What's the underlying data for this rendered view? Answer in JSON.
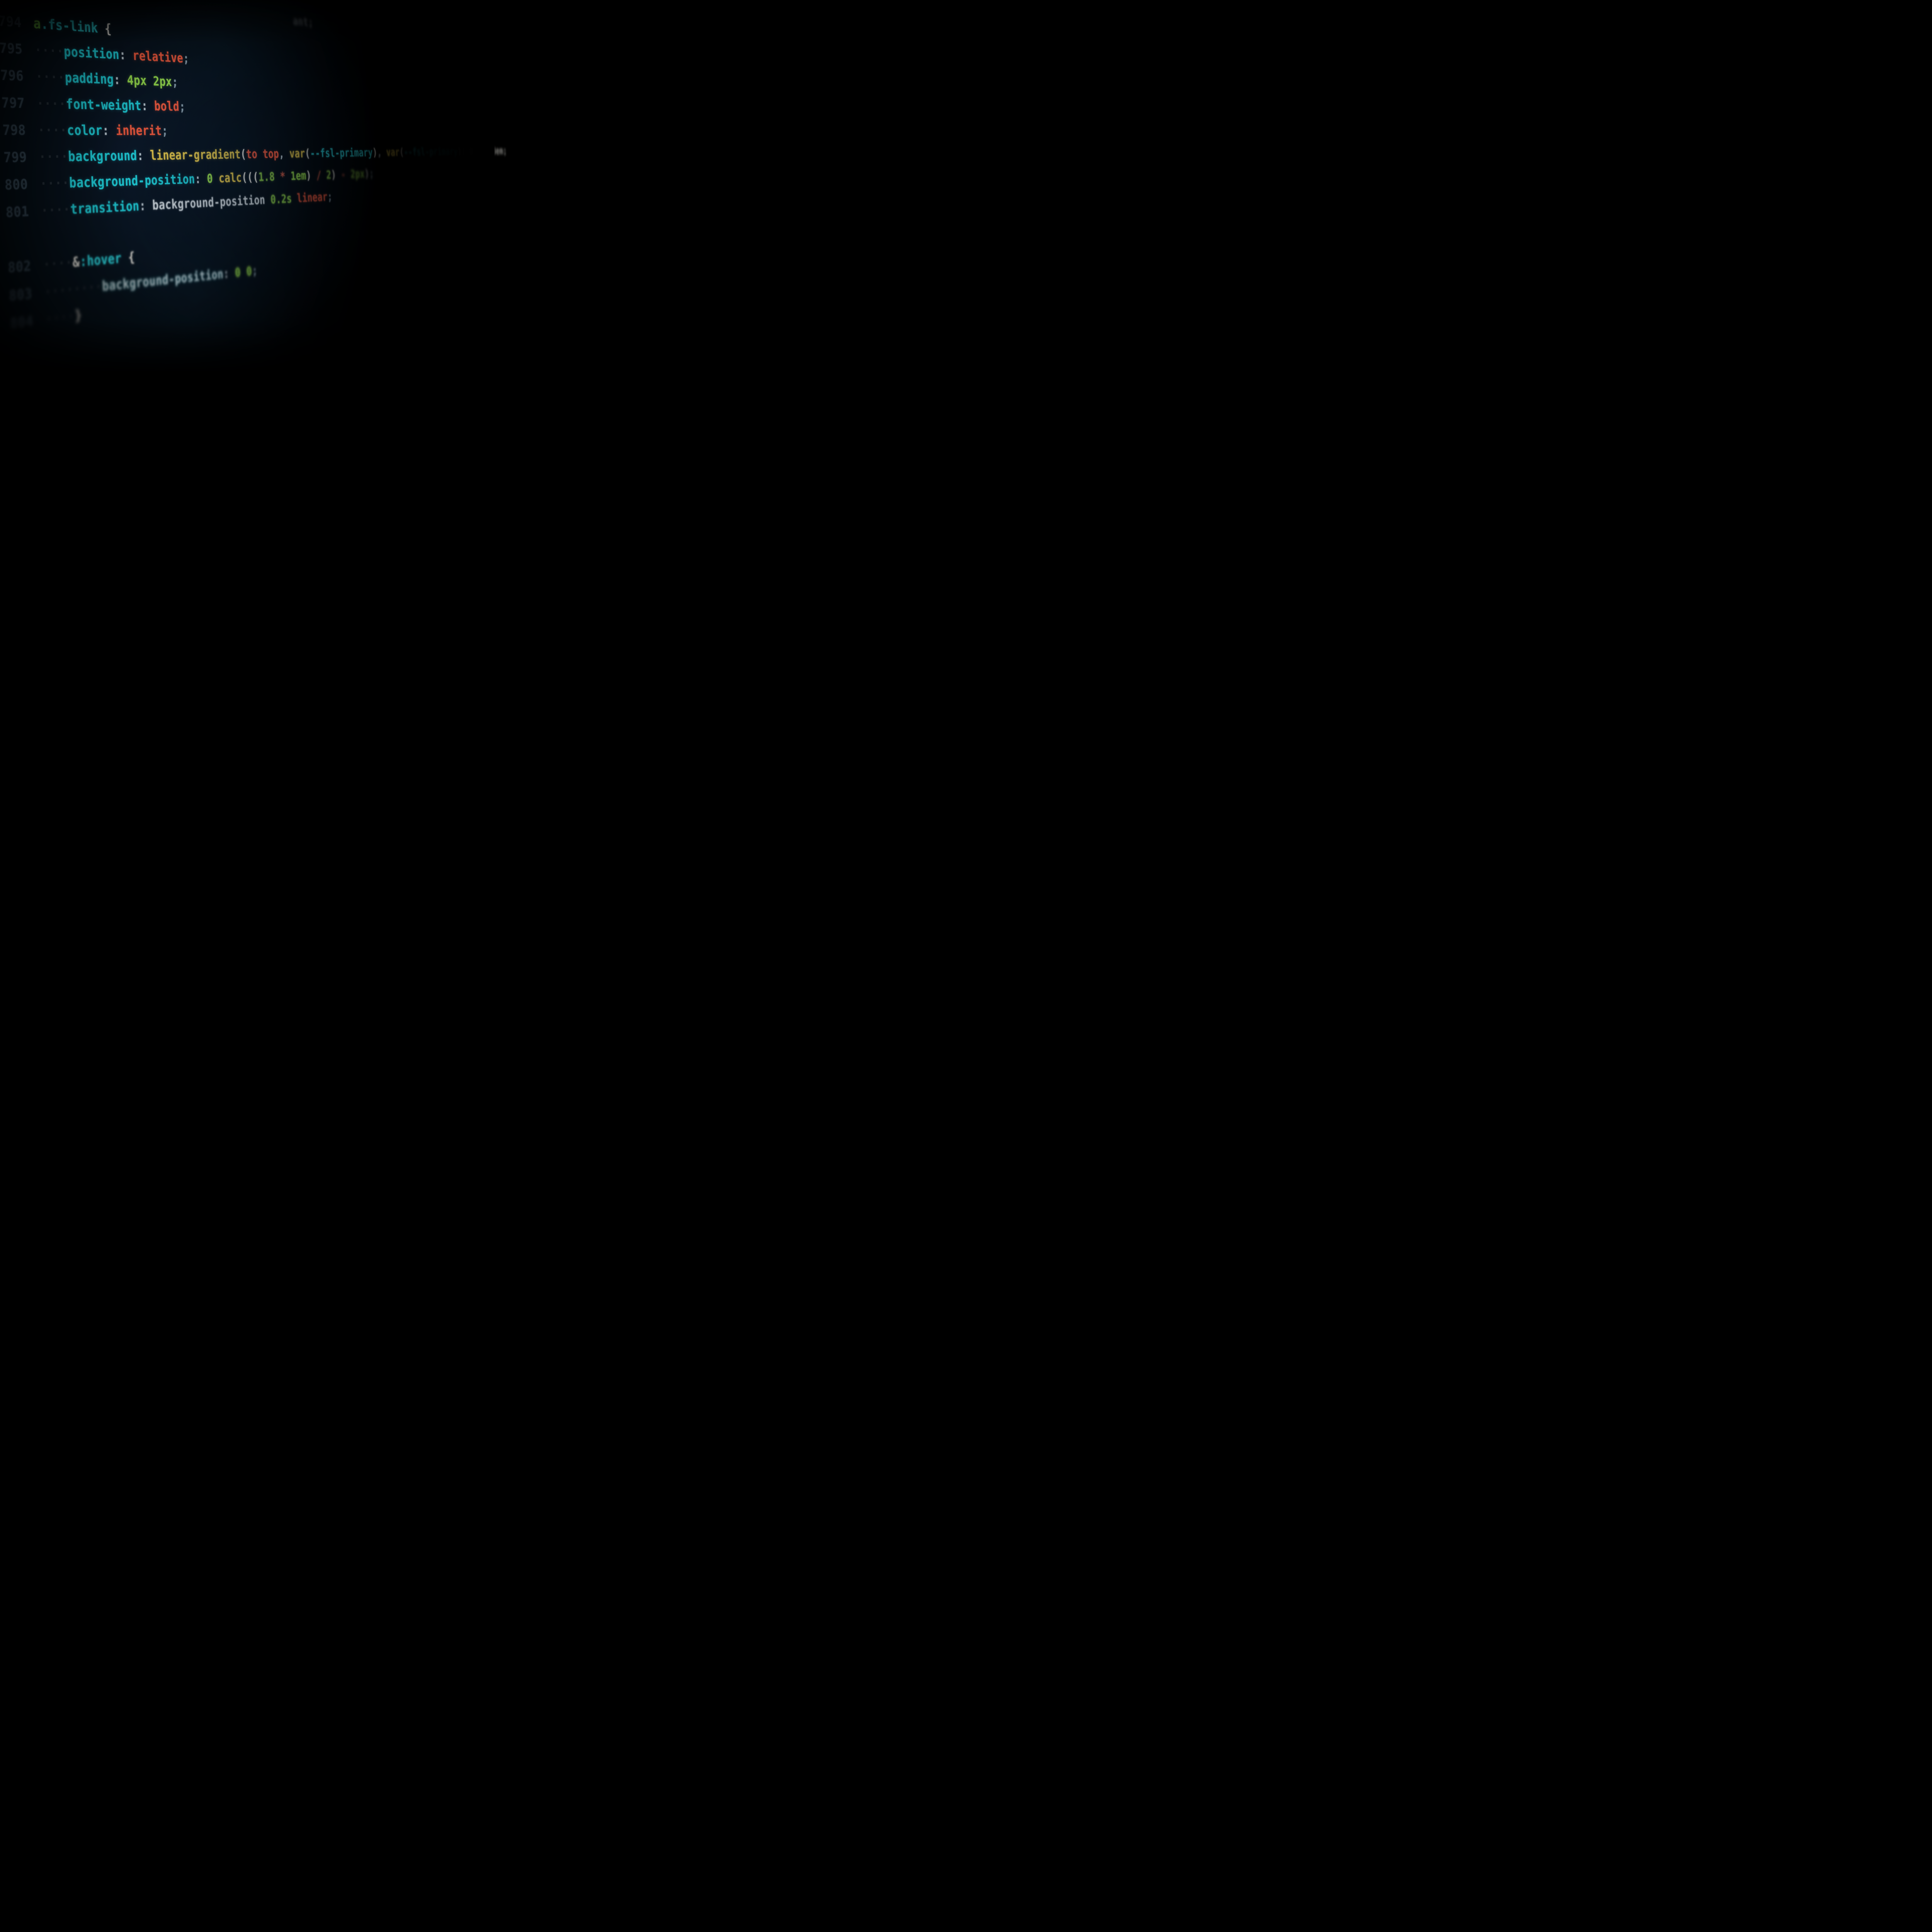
{
  "gutter": {
    "start": 794,
    "lines": [
      "794",
      "795",
      "796",
      "797",
      "798",
      "799",
      "800",
      "801",
      "802",
      "803",
      "804"
    ]
  },
  "top_fragment": "ant;",
  "code": {
    "selector_tag": "a",
    "selector_class": ".fs-link",
    "brace_open": " {",
    "brace_close": "}",
    "indent_dots_1": "····",
    "indent_dots_2": "········",
    "rules": [
      {
        "prop": "position",
        "value_kw": "relative"
      },
      {
        "prop": "padding",
        "value_nums": [
          "4px",
          "2px"
        ]
      },
      {
        "prop": "font-weight",
        "value_kw": "bold"
      },
      {
        "prop": "color",
        "value_kw": "inherit"
      },
      {
        "prop": "background",
        "func": "linear-gradient",
        "args_leading_kw": "to",
        "args_leading_kw2": "top",
        "comma": ",",
        "var_func": "var",
        "var1": "--fsl-primary",
        "var2": "--fsl-primary",
        "trail": ") 0 / 1.8em;"
      },
      {
        "prop": "background-position",
        "leading_num": "0",
        "func": "calc",
        "expr_open": "(((",
        "n1": "1.8",
        "op1": " * ",
        "unit1": "1em",
        "close1": ")",
        "op2": " / ",
        "n2": "2",
        "close2": ")",
        "op3": " - ",
        "n3": "2px",
        "close3": ")"
      },
      {
        "prop": "transition",
        "ident": "background-position",
        "dur": "0.2s",
        "easing": "linear"
      }
    ],
    "nested": {
      "amp": "&",
      "pseudo": ":hover",
      "brace_open": " {",
      "rule": {
        "prop": "background-position",
        "v1": "0",
        "v2": "0"
      },
      "brace_close": "}"
    }
  }
}
